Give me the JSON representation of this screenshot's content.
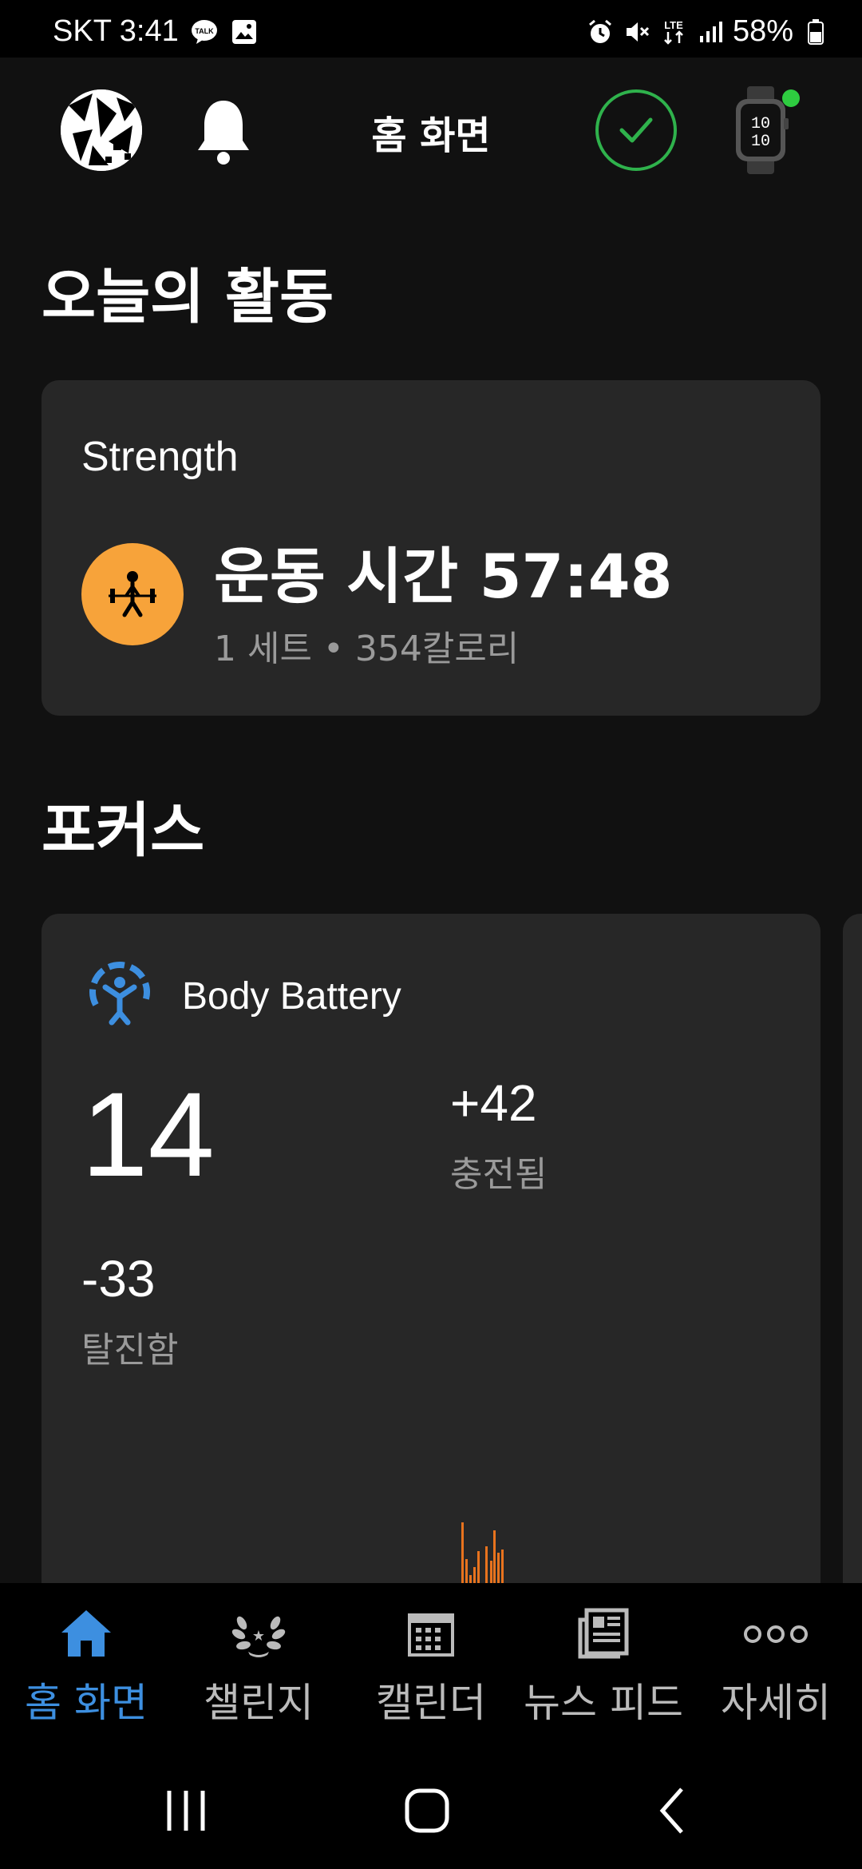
{
  "status_bar": {
    "carrier_time": "SKT 3:41",
    "network": "LTE",
    "battery": "58%"
  },
  "header": {
    "title": "홈 화면",
    "icons": [
      "avatar",
      "bell-icon",
      "sync-check-icon",
      "watch-icon"
    ]
  },
  "activity": {
    "section_title": "오늘의 활동",
    "type": "Strength",
    "main": "운동 시간 57:48",
    "sub": "1 세트 • 354칼로리",
    "icon": "weightlifting-icon",
    "icon_color": "#f7a33a"
  },
  "focus": {
    "section_title": "포커스",
    "body_battery": {
      "title": "Body Battery",
      "level": "14",
      "charged_value": "+42",
      "charged_label": "충전됨",
      "drained_value": "-33",
      "drained_label": "탈진함",
      "icon_color": "#3d8fe0",
      "chart_color": "#e8731e"
    }
  },
  "bottom_nav": {
    "items": [
      {
        "label": "홈 화면",
        "icon": "home-icon",
        "active": true
      },
      {
        "label": "챌린지",
        "icon": "laurel-icon",
        "active": false
      },
      {
        "label": "캘린더",
        "icon": "calendar-icon",
        "active": false
      },
      {
        "label": "뉴스 피드",
        "icon": "newspaper-icon",
        "active": false
      },
      {
        "label": "자세히",
        "icon": "more-icon",
        "active": false
      }
    ],
    "active_color": "#3d8fe0"
  }
}
